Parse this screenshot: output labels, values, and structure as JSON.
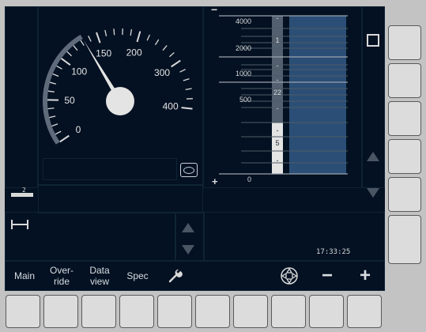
{
  "speedometer": {
    "current_speed": "133",
    "scale_labels": [
      "0",
      "50",
      "100",
      "150",
      "200",
      "300",
      "400"
    ]
  },
  "planning": {
    "distance_labels": [
      "4000",
      "2000",
      "1000",
      "500",
      "0"
    ],
    "speed_labels": [
      "-",
      "1",
      "-",
      "-",
      "22",
      "-",
      "-",
      "5",
      "-"
    ],
    "zoom_out": "−",
    "zoom_in": "+"
  },
  "gradient": {
    "value": "2"
  },
  "clock": "17:33:25",
  "menu": {
    "main": "Main",
    "override_line1": "Over-",
    "override_line2": "ride",
    "dataview_line1": "Data",
    "dataview_line2": "view",
    "spec": "Spec",
    "minus": "−",
    "plus": "+"
  },
  "colors": {
    "panel_bg": "#031122",
    "speed_arc": "#5f6b7a",
    "planning_bar": "#2b4e76",
    "indicator_white": "#d9d9d9"
  }
}
